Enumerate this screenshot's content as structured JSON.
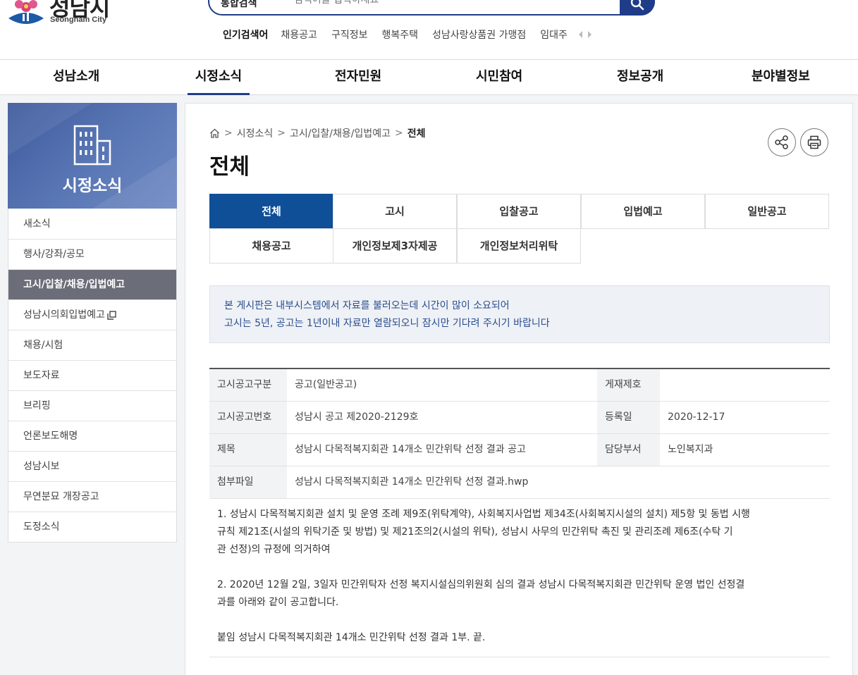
{
  "header": {
    "logo_kr": "성남시",
    "logo_en": "Seongnam City",
    "search": {
      "select_label": "통합검색",
      "placeholder": "검색어를 입력하세요"
    },
    "popular": {
      "label": "인기검색어",
      "items": [
        "채용공고",
        "구직정보",
        "행복주택",
        "성남사랑상품권 가맹점",
        "임대주"
      ]
    }
  },
  "gnb": [
    "성남소개",
    "시정소식",
    "전자민원",
    "시민참여",
    "정보공개",
    "분야별정보"
  ],
  "sidebar": {
    "title": "시정소식",
    "items": [
      {
        "label": "새소식"
      },
      {
        "label": "행사/강좌/공모"
      },
      {
        "label": "고시/입찰/채용/입법예고"
      },
      {
        "label": "성남시의회입법예고"
      },
      {
        "label": "채용/시험"
      },
      {
        "label": "보도자료"
      },
      {
        "label": "브리핑"
      },
      {
        "label": "언론보도해명"
      },
      {
        "label": "성남시보"
      },
      {
        "label": "무연분묘 개장공고"
      },
      {
        "label": "도정소식"
      }
    ]
  },
  "breadcrumb": [
    "시정소식",
    "고시/입찰/채용/입법예고",
    "전체"
  ],
  "page_title": "전체",
  "tabs": [
    "전체",
    "고시",
    "입찰공고",
    "입법예고",
    "일반공고",
    "채용공고",
    "개인정보제3자제공",
    "개인정보처리위탁"
  ],
  "notice": {
    "line1": "본 게시판은 내부시스템에서 자료를 불러오는데 시간이 많이 소요되어",
    "line2": "고시는 5년, 공고는 1년이내 자료만 열람되오니 잠시만 기다려 주시기 바랍니다"
  },
  "detail": {
    "type_label": "고시공고구분",
    "type_value": "공고(일반공고)",
    "pub_label": "게재제호",
    "pub_value": "",
    "num_label": "고시공고번호",
    "num_value": "성남시 공고 제2020-2129호",
    "date_label": "등록일",
    "date_value": "2020-12-17",
    "title_label": "제목",
    "title_value": "성남시 다목적복지회관 14개소 민간위탁 선정 결과 공고",
    "dept_label": "담당부서",
    "dept_value": "노인복지과",
    "file_label": "첨부파일",
    "file_value": "성남시 다목적복지회관 14개소 민간위탁 선정 결과.hwp",
    "body": {
      "p1_l1": "1. 성남시 다목적복지회관 설치 및 운영 조례 제9조(위탁계약), 사회복지사업법 제34조(사회복지시설의 설치) 제5항 및 동법 시행",
      "p1_l2": "규칙 제21조(시설의 위탁기준 및 방법)  및 제21조의2(시설의 위탁), 성남시 사무의 민간위탁 촉진 및 관리조례 제6조(수탁 기",
      "p1_l3": "관 선정)의 규정에 의거하여",
      "p2_l1": "2. 2020년 12월 2일, 3일자 민간위탁자 선정 복지시설심의위원회 심의 결과  성남시 다목적복지회관 민간위탁 운영 법인 선정결",
      "p2_l2": "과를 아래와 같이 공고합니다.",
      "p3": "붙임 성남시 다목적복지회관 14개소 민간위탁 선정 결과 1부.  끝."
    }
  },
  "colors": {
    "brand": "#1f3c88",
    "tab_active": "#0e4f97",
    "side_active": "#6b6e79"
  }
}
